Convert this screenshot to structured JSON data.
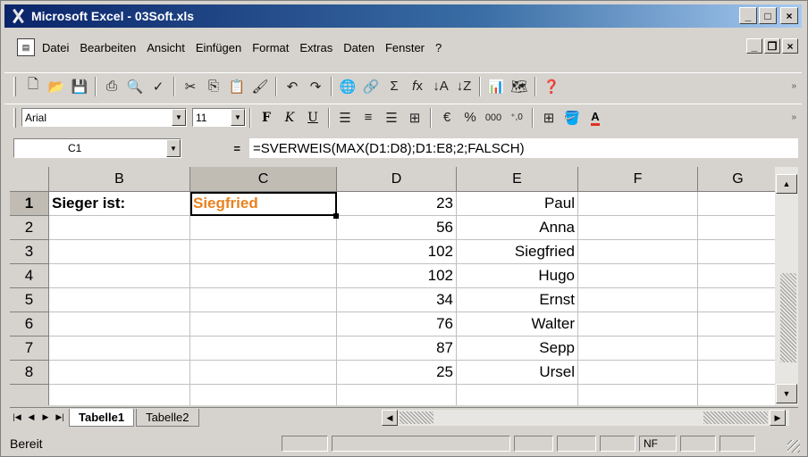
{
  "window": {
    "title": "Microsoft Excel - 03Soft.xls"
  },
  "title_buttons": {
    "minimize": "_",
    "maximize": "□",
    "close": "×"
  },
  "menu": [
    "Datei",
    "Bearbeiten",
    "Ansicht",
    "Einfügen",
    "Format",
    "Extras",
    "Daten",
    "Fenster",
    "?"
  ],
  "doc_buttons": {
    "minimize": "_",
    "restore": "❐",
    "close": "×"
  },
  "standard_toolbar": {
    "buttons": [
      "new-icon",
      "open-icon",
      "save-icon",
      "print-icon",
      "print-preview-icon",
      "spelling-icon",
      "cut-icon",
      "copy-icon",
      "paste-icon",
      "format-painter-icon",
      "undo-icon",
      "redo-icon",
      "hyperlink-icon",
      "web-icon",
      "autosum-icon",
      "function-icon",
      "sort-ascending-icon",
      "sort-descending-icon",
      "chart-wizard-icon",
      "drawing-icon",
      "help-icon"
    ]
  },
  "formatting_toolbar": {
    "font": "Arial",
    "size": "11",
    "bold": "F",
    "italic": "K",
    "underline": "U",
    "percent": "%",
    "thousands": "000"
  },
  "formula_bar": {
    "name_box": "C1",
    "equals": "=",
    "formula": "=SVERWEIS(MAX(D1:D8);D1:E8;2;FALSCH)"
  },
  "columns": [
    "B",
    "C",
    "D",
    "E",
    "F",
    "G"
  ],
  "rows": [
    {
      "n": "1",
      "B": "Sieger ist:",
      "C": "Siegfried",
      "D": "23",
      "E": "Paul"
    },
    {
      "n": "2",
      "B": "",
      "C": "",
      "D": "56",
      "E": "Anna"
    },
    {
      "n": "3",
      "B": "",
      "C": "",
      "D": "102",
      "E": "Siegfried"
    },
    {
      "n": "4",
      "B": "",
      "C": "",
      "D": "102",
      "E": "Hugo"
    },
    {
      "n": "5",
      "B": "",
      "C": "",
      "D": "34",
      "E": "Ernst"
    },
    {
      "n": "6",
      "B": "",
      "C": "",
      "D": "76",
      "E": "Walter"
    },
    {
      "n": "7",
      "B": "",
      "C": "",
      "D": "87",
      "E": "Sepp"
    },
    {
      "n": "8",
      "B": "",
      "C": "",
      "D": "25",
      "E": "Ursel"
    }
  ],
  "sheets": [
    "Tabelle1",
    "Tabelle2"
  ],
  "status": {
    "text": "Bereit",
    "nf": "NF"
  },
  "colors": {
    "accent_text": "#e8821e",
    "titlebar": "#0a246a"
  }
}
